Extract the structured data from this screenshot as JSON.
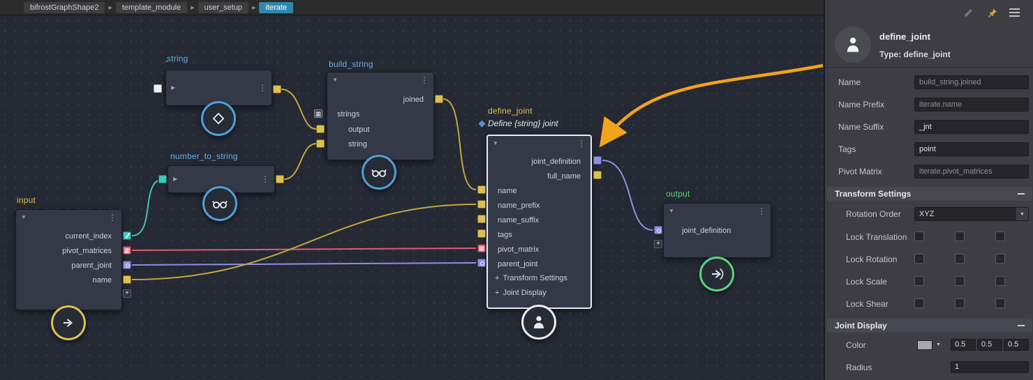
{
  "breadcrumb": {
    "items": [
      "bifrostGraphShape2",
      "template_module",
      "user_setup",
      "iterate"
    ]
  },
  "graph": {
    "string_node": {
      "title": "string",
      "value_preview": "\""
    },
    "number_to_string_node": {
      "title": "number_to_string"
    },
    "build_string_node": {
      "title": "build_string",
      "output": "joined",
      "group": "strings",
      "children": [
        "output",
        "string"
      ]
    },
    "input_node": {
      "title": "input",
      "outputs": [
        "current_index",
        "pivot_matrices",
        "parent_joint",
        "name"
      ]
    },
    "define_joint_node": {
      "title": "define_joint",
      "subtitle": "Define {string} joint",
      "outputs": [
        "joint_definition",
        "full_name"
      ],
      "inputs": [
        "name",
        "name_prefix",
        "name_suffix",
        "tags",
        "pivot_matrix",
        "parent_joint"
      ],
      "groups": [
        "Transform Settings",
        "Joint Display"
      ]
    },
    "output_node": {
      "title": "output",
      "inputs": [
        "joint_definition"
      ]
    }
  },
  "panel": {
    "header": {
      "title": "define_joint",
      "type": "Type: define_joint"
    },
    "fields": [
      {
        "label": "Name",
        "value": "build_string.joined",
        "connected": true
      },
      {
        "label": "Name Prefix",
        "value": "iterate.name",
        "connected": true
      },
      {
        "label": "Name Suffix",
        "value": "_jnt",
        "connected": false
      },
      {
        "label": "Tags",
        "value": "point",
        "connected": false
      },
      {
        "label": "Pivot Matrix",
        "value": "iterate.pivot_matrices",
        "connected": true
      }
    ],
    "transform_settings": {
      "title": "Transform Settings",
      "rotation_order_label": "Rotation Order",
      "rotation_order_value": "XYZ",
      "locks": [
        "Lock Translation",
        "Lock Rotation",
        "Lock Scale",
        "Lock Shear"
      ]
    },
    "joint_display": {
      "title": "Joint Display",
      "color_label": "Color",
      "color_values": [
        "0.5",
        "0.5",
        "0.5"
      ],
      "radius_label": "Radius",
      "radius_value": "1"
    }
  },
  "colors": {
    "port_yellow": "#dcbf53",
    "port_red": "#e15c70",
    "port_purple": "#8e90e8",
    "port_teal": "#3fc6bd",
    "wire_yellow": "#c2a644",
    "node_title_blue": "#66b0e2",
    "node_title_yellow": "#dfc04f",
    "node_title_green": "#57d37d",
    "annotation_arrow": "#f0a41c",
    "breadcrumb_active": "#2f87ad"
  }
}
